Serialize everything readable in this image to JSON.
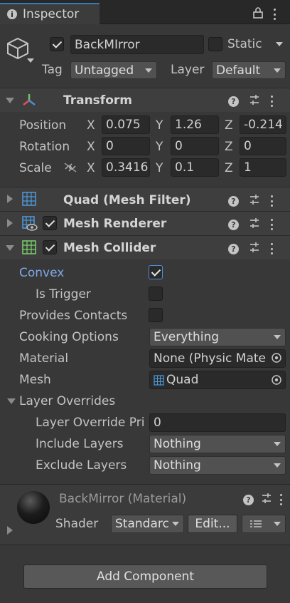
{
  "tab": {
    "title": "Inspector"
  },
  "object": {
    "name": "BackMIrror",
    "static_label": "Static",
    "tag_label": "Tag",
    "tag_value": "Untagged",
    "layer_label": "Layer",
    "layer_value": "Default"
  },
  "transform": {
    "title": "Transform",
    "rows": [
      {
        "label": "Position",
        "x": "0.075",
        "y": "1.26",
        "z": "-0.214"
      },
      {
        "label": "Rotation",
        "x": "0",
        "y": "0",
        "z": "0"
      },
      {
        "label": "Scale",
        "x": "0.3416",
        "y": "0.1",
        "z": "1"
      }
    ],
    "axes": {
      "x": "X",
      "y": "Y",
      "z": "Z"
    }
  },
  "components": {
    "quad": "Quad (Mesh Filter)",
    "renderer": "Mesh Renderer",
    "collider": "Mesh Collider"
  },
  "collider": {
    "convex": "Convex",
    "is_trigger": "Is Trigger",
    "provides_contacts": "Provides Contacts",
    "cooking_label": "Cooking Options",
    "cooking_value": "Everything",
    "material_label": "Material",
    "material_value": "None (Physic Mate",
    "mesh_label": "Mesh",
    "mesh_value": "Quad",
    "overrides_label": "Layer Overrides",
    "override_priority_label": "Layer Override Pri",
    "override_priority_value": "0",
    "include_label": "Include Layers",
    "include_value": "Nothing",
    "exclude_label": "Exclude Layers",
    "exclude_value": "Nothing"
  },
  "material": {
    "title": "BackMirror (Material)",
    "shader_label": "Shader",
    "shader_value": "Standarc",
    "edit_label": "Edit..."
  },
  "footer": {
    "add_component": "Add Component"
  },
  "colors": {
    "accent": "#3a79bb",
    "link_blue": "#7ca9e8",
    "background": "#383838"
  }
}
